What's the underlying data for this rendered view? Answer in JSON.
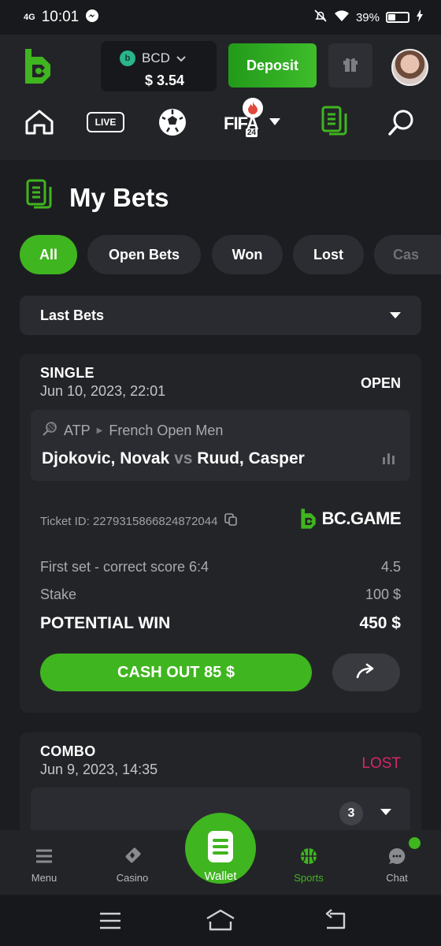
{
  "status_bar": {
    "network": "4G",
    "time": "10:01",
    "battery_percent": "39%",
    "battery_level": 0.39
  },
  "header": {
    "currency": "BCD",
    "coin_letter": "b",
    "balance": "$ 3.54",
    "deposit_label": "Deposit"
  },
  "sport_nav": {
    "items": [
      "home-icon",
      "live-badge",
      "soccer-icon",
      "fifa-24-icon",
      "bets-icon",
      "search-icon"
    ],
    "live_label": "LIVE",
    "fifa_label": "FIFA",
    "fifa_sub": "24",
    "active": "bets-icon"
  },
  "page": {
    "title": "My Bets"
  },
  "filters": {
    "tabs": [
      "All",
      "Open Bets",
      "Won",
      "Lost",
      "Cas"
    ],
    "active": "All"
  },
  "dropdown": {
    "selected": "Last Bets"
  },
  "bets": [
    {
      "type": "SINGLE",
      "date": "Jun 10, 2023, 22:01",
      "status": "OPEN",
      "sport": "ATP",
      "league": "French Open Men",
      "home": "Djokovic, Novak",
      "vs": "vs",
      "away": "Ruud, Casper",
      "ticket_label": "Ticket ID: 2279315866824872044",
      "brand": "BC.GAME",
      "market": "First set - correct score 6:4",
      "odds": "4.5",
      "stake_label": "Stake",
      "stake": "100 $",
      "potential_label": "POTENTIAL WIN",
      "potential": "450 $",
      "cashout_label": "CASH OUT 85 $"
    },
    {
      "type": "COMBO",
      "date": "Jun 9, 2023, 14:35",
      "status": "LOST",
      "count": "3"
    }
  ],
  "bottom_nav": {
    "items": [
      "Menu",
      "Casino",
      "Wallet",
      "Sports",
      "Chat"
    ],
    "active": "Sports"
  },
  "colors": {
    "accent": "#3fb51f",
    "background": "#1c1d21",
    "card": "#232428",
    "lost": "#d6266a"
  }
}
